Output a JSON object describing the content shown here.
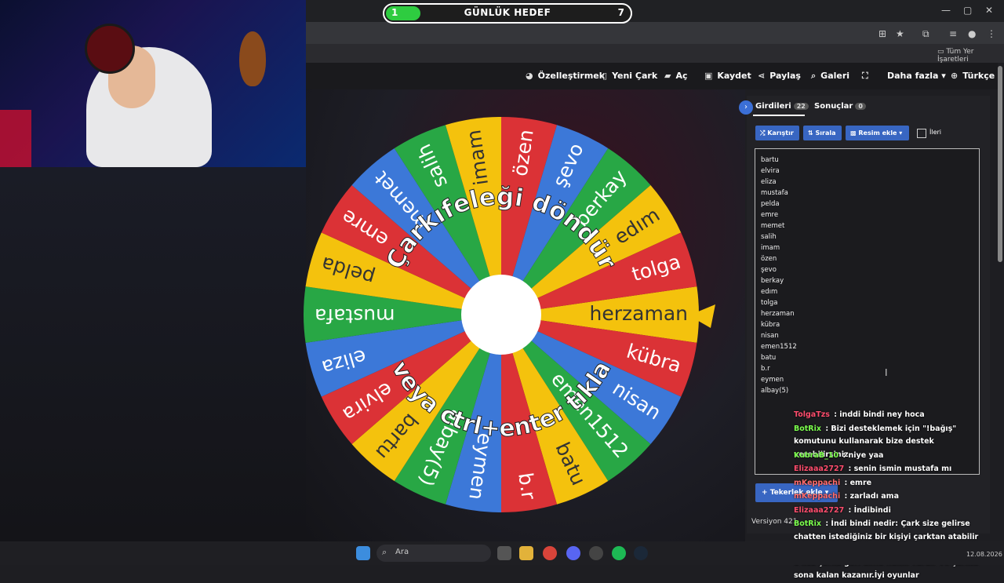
{
  "goal": {
    "title": "GÜNLÜK HEDEF",
    "current": "1",
    "target": "7",
    "progress": 0.14,
    "fill_color": "#2ecc40"
  },
  "window": {
    "minimize": "—",
    "restore": "▢",
    "close": "✕"
  },
  "browser": {
    "bookmarks_label": "Tüm Yer İşaretleri"
  },
  "toolbar": {
    "customize": "Özelleştirmek",
    "new_wheel": "Yeni Çark",
    "open": "Aç",
    "save": "Kaydet",
    "share": "Paylaş",
    "gallery": "Galeri",
    "more": "Daha fazla",
    "language": "Türkçe"
  },
  "wheel": {
    "overlay_top": "Çarkıfeleği döndür",
    "overlay_bottom": "veya ctrl+enter tıkla",
    "colors": [
      "#f4c20d",
      "#db3236",
      "#3c78d8",
      "#28a745"
    ],
    "slices": [
      "herzaman",
      "kübra",
      "nisan",
      "emen1512",
      "batu",
      "b.r",
      "eymen",
      "albay(5)",
      "bartu",
      "elvira",
      "eliza",
      "mustafa",
      "pelda",
      "emre",
      "memet",
      "salih",
      "imam",
      "özen",
      "şevo",
      "berkay",
      "edım",
      "tolga"
    ],
    "pointer_color": "#f4c20d"
  },
  "panel": {
    "tab_entries": "Girdileri",
    "entries_count": "22",
    "tab_results": "Sonuçlar",
    "results_count": "0",
    "shuffle": "Karıştır",
    "sort": "Sırala",
    "add_image": "Resim ekle",
    "advanced": "İleri",
    "entries": [
      "bartu",
      "elvira",
      "eliza",
      "mustafa",
      "pelda",
      "emre",
      "memet",
      "salih",
      "imam",
      "özen",
      "şevo",
      "berkay",
      "edım",
      "tolga",
      "herzaman",
      "kübra",
      "nisan",
      "emen1512",
      "batu",
      "b.r",
      "eymen",
      "albay(5)"
    ],
    "add_wheel": "Tekerlek ekle",
    "version": "Versiyon 421"
  },
  "chat": [
    {
      "user": "TolgaTzs",
      "color": "#ff4d6d",
      "text": ": inddi bindi ney hoca"
    },
    {
      "user": "BotRix",
      "color": "#7cff4d",
      "text": ": Bizi desteklemek için \"!bağış\" komutunu kullanarak bize destek verebilirsiniz"
    },
    {
      "user": "KubraB_10",
      "color": "#7cff4d",
      "text": ": niye yaa"
    },
    {
      "user": "Elizaaa2727",
      "color": "#ff4d6d",
      "text": ": senin ismin mustafa mı"
    },
    {
      "user": "mKeppachi",
      "color": "#ff6a6a",
      "text": ": emre"
    },
    {
      "user": "mKeppachi",
      "color": "#ff6a6a",
      "text": ": zarladı ama"
    },
    {
      "user": "Elizaaa2727",
      "color": "#ff4d6d",
      "text": ": İndibindi"
    },
    {
      "user": "BotRix",
      "color": "#7cff4d",
      "text": ": İndi bindi nedir: Çark size gelirse chatten istediğiniz bir kişiyi çarktan atabilir veya çarka geri ekleyebilirsiniz.Fakat herkesin 1 kez çarka geri alma hakkı vardır ve çarkta sona kalan kazanır.İyi oyunlar"
    }
  ],
  "taskbar": {
    "search_label": "Ara",
    "date": "12.08.2026"
  }
}
